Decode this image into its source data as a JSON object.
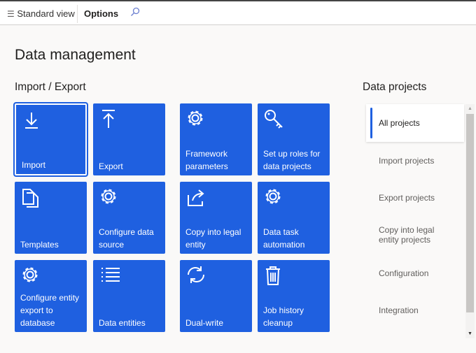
{
  "toolbar": {
    "standard_view": "Standard view",
    "options": "Options"
  },
  "page_title": "Data management",
  "import_export": {
    "heading": "Import / Export",
    "tiles": [
      {
        "label": "Import",
        "icon": "download-icon"
      },
      {
        "label": "Export",
        "icon": "upload-icon"
      },
      {
        "label": "Framework parameters",
        "icon": "gear-icon"
      },
      {
        "label": "Set up roles for data projects",
        "icon": "key-icon"
      },
      {
        "label": "Templates",
        "icon": "documents-icon"
      },
      {
        "label": "Configure data source",
        "icon": "gear-icon"
      },
      {
        "label": "Copy into legal entity",
        "icon": "share-icon"
      },
      {
        "label": "Data task automation",
        "icon": "gear-icon"
      },
      {
        "label": "Configure entity export to database",
        "icon": "gear-icon"
      },
      {
        "label": "Data entities",
        "icon": "list-icon"
      },
      {
        "label": "Dual-write",
        "icon": "sync-icon"
      },
      {
        "label": "Job history cleanup",
        "icon": "trash-icon"
      }
    ]
  },
  "data_projects": {
    "heading": "Data projects",
    "items": [
      "All projects",
      "Import projects",
      "Export projects",
      "Copy into legal entity projects",
      "Configuration",
      "Integration"
    ],
    "active": 0
  },
  "colors": {
    "tile": "#1f60e0"
  }
}
